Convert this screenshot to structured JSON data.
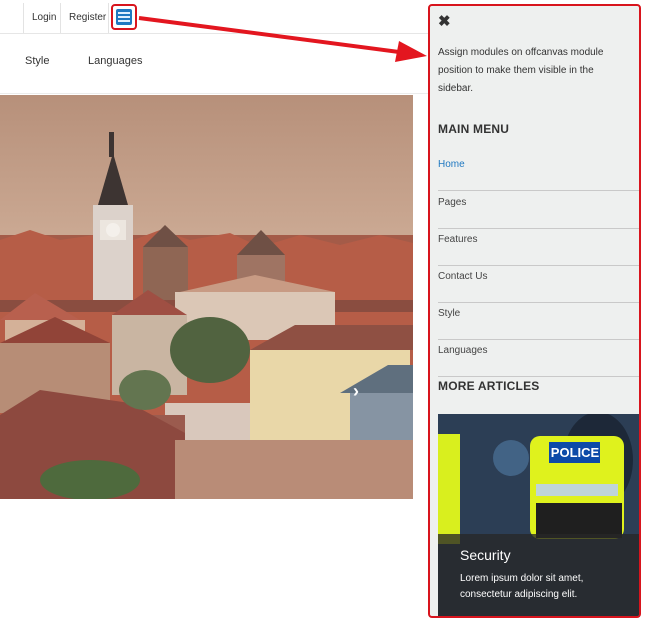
{
  "topbar": {
    "login": "Login",
    "register": "Register"
  },
  "nav": {
    "style": "Style",
    "languages": "Languages"
  },
  "sidebar": {
    "close_icon": "close-icon",
    "note": "Assign modules on offcanvas module position to make them visible in the sidebar.",
    "main_menu_title": "MAIN MENU",
    "items": [
      {
        "label": "Home"
      },
      {
        "label": "Pages",
        "expand": "+"
      },
      {
        "label": "Features",
        "expand": "+"
      },
      {
        "label": "Contact Us"
      },
      {
        "label": "Style",
        "expand": "+"
      },
      {
        "label": "Languages",
        "expand": "+"
      }
    ],
    "more_articles_title": "MORE ARTICLES",
    "article": {
      "title": "Security",
      "text": "Lorem ipsum dolor sit amet, consectetur adipiscing elit.",
      "police_sign": "POLICE"
    }
  },
  "colors": {
    "accent": "#1f78c1",
    "highlight": "#d8141d",
    "sidebar_bg": "#eef0ef"
  },
  "icons": {
    "menu": "hamburger-menu-icon",
    "next": "chevron-right-icon",
    "plus": "plus-icon"
  }
}
